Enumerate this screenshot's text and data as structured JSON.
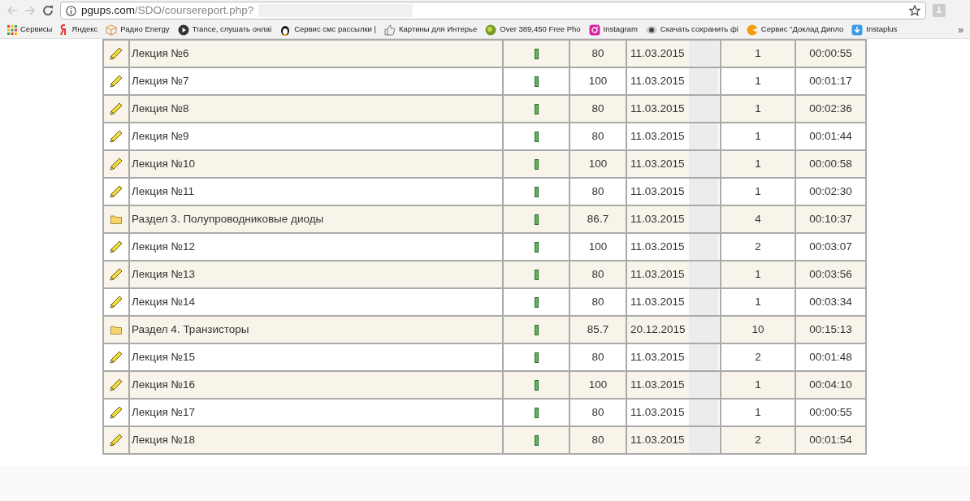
{
  "browser": {
    "url_host": "pgups.com",
    "url_path": "/SDO/coursereport.php?"
  },
  "bookmarks": [
    {
      "label": "Сервисы"
    },
    {
      "label": "Яндекс"
    },
    {
      "label": "Радио Energy"
    },
    {
      "label": "Trance, слушать онлаі"
    },
    {
      "label": "Сервис смс рассылки |"
    },
    {
      "label": "Картины для Интерье"
    },
    {
      "label": "Over 389,450 Free Pho"
    },
    {
      "label": "Instagram"
    },
    {
      "label": "Скачать сохранить фі"
    },
    {
      "label": "Сервис \"Доклад Дипло"
    },
    {
      "label": "Instaplus"
    }
  ],
  "bookmarks_more": "»",
  "rows": [
    {
      "kind": "lecture",
      "title": "Лекция №6",
      "score": "80",
      "date": "11.03.2015",
      "attempts": "1",
      "time": "00:00:55"
    },
    {
      "kind": "lecture",
      "title": "Лекция №7",
      "score": "100",
      "date": "11.03.2015",
      "attempts": "1",
      "time": "00:01:17"
    },
    {
      "kind": "lecture",
      "title": "Лекция №8",
      "score": "80",
      "date": "11.03.2015",
      "attempts": "1",
      "time": "00:02:36"
    },
    {
      "kind": "lecture",
      "title": "Лекция №9",
      "score": "80",
      "date": "11.03.2015",
      "attempts": "1",
      "time": "00:01:44"
    },
    {
      "kind": "lecture",
      "title": "Лекция №10",
      "score": "100",
      "date": "11.03.2015",
      "attempts": "1",
      "time": "00:00:58"
    },
    {
      "kind": "lecture",
      "title": "Лекция №11",
      "score": "80",
      "date": "11.03.2015",
      "attempts": "1",
      "time": "00:02:30"
    },
    {
      "kind": "section",
      "title": "Раздел 3. Полупроводниковые диоды",
      "score": "86.7",
      "date": "11.03.2015",
      "attempts": "4",
      "time": "00:10:37"
    },
    {
      "kind": "lecture",
      "title": "Лекция №12",
      "score": "100",
      "date": "11.03.2015",
      "attempts": "2",
      "time": "00:03:07"
    },
    {
      "kind": "lecture",
      "title": "Лекция №13",
      "score": "80",
      "date": "11.03.2015",
      "attempts": "1",
      "time": "00:03:56"
    },
    {
      "kind": "lecture",
      "title": "Лекция №14",
      "score": "80",
      "date": "11.03.2015",
      "attempts": "1",
      "time": "00:03:34"
    },
    {
      "kind": "section",
      "title": "Раздел 4. Транзисторы",
      "score": "85.7",
      "date": "20.12.2015",
      "attempts": "10",
      "time": "00:15:13"
    },
    {
      "kind": "lecture",
      "title": "Лекция №15",
      "score": "80",
      "date": "11.03.2015",
      "attempts": "2",
      "time": "00:01:48"
    },
    {
      "kind": "lecture",
      "title": "Лекция №16",
      "score": "100",
      "date": "11.03.2015",
      "attempts": "1",
      "time": "00:04:10"
    },
    {
      "kind": "lecture",
      "title": "Лекция №17",
      "score": "80",
      "date": "11.03.2015",
      "attempts": "1",
      "time": "00:00:55"
    },
    {
      "kind": "lecture",
      "title": "Лекция №18",
      "score": "80",
      "date": "11.03.2015",
      "attempts": "2",
      "time": "00:01:54"
    }
  ]
}
